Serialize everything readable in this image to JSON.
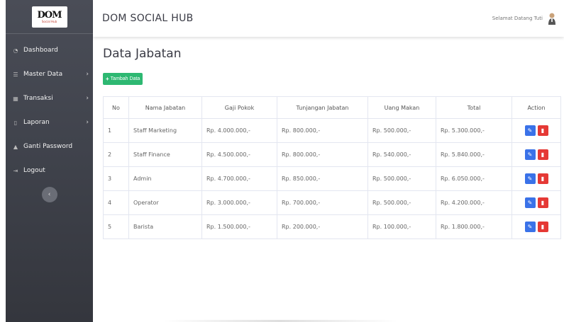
{
  "brand": {
    "logo_text": "DOM",
    "logo_sub": "Social Hub"
  },
  "sidebar": {
    "items": [
      {
        "label": "Dashboard",
        "icon": "dashboard-icon",
        "has_chevron": false
      },
      {
        "label": "Master Data",
        "icon": "list-icon",
        "has_chevron": true
      },
      {
        "label": "Transaksi",
        "icon": "table-icon",
        "has_chevron": true
      },
      {
        "label": "Laporan",
        "icon": "file-icon",
        "has_chevron": true
      },
      {
        "label": "Ganti Password",
        "icon": "lock-icon",
        "has_chevron": false
      },
      {
        "label": "Logout",
        "icon": "logout-icon",
        "has_chevron": false
      }
    ],
    "toggle_icon": "chevron-left-icon"
  },
  "header": {
    "title": "DOM SOCIAL HUB",
    "greeting": "Selamat Datang Tuti"
  },
  "main": {
    "page_title": "Data Jabatan",
    "add_button": "Tambah Data",
    "table": {
      "headers": [
        "No",
        "Nama Jabatan",
        "Gaji Pokok",
        "Tunjangan Jabatan",
        "Uang Makan",
        "Total",
        "Action"
      ],
      "rows": [
        [
          "1",
          "Staff Marketing",
          "Rp. 4.000.000,-",
          "Rp. 800.000,-",
          "Rp. 500.000,-",
          "Rp. 5.300.000,-"
        ],
        [
          "2",
          "Staff Finance",
          "Rp. 4.500.000,-",
          "Rp. 800.000,-",
          "Rp. 540.000,-",
          "Rp. 5.840.000,-"
        ],
        [
          "3",
          "Admin",
          "Rp. 4.700.000,-",
          "Rp. 850.000,-",
          "Rp. 500.000,-",
          "Rp. 6.050.000,-"
        ],
        [
          "4",
          "Operator",
          "Rp. 3.000.000,-",
          "Rp. 700.000,-",
          "Rp. 500.000,-",
          "Rp. 4.200.000,-"
        ],
        [
          "5",
          "Barista",
          "Rp. 1.500.000,-",
          "Rp. 200.000,-",
          "Rp. 100.000,-",
          "Rp. 1.800.000,-"
        ]
      ]
    }
  },
  "colors": {
    "sidebar": "#3f424b",
    "add_button": "#2eb872",
    "edit": "#3a72e8",
    "delete": "#e53935"
  }
}
